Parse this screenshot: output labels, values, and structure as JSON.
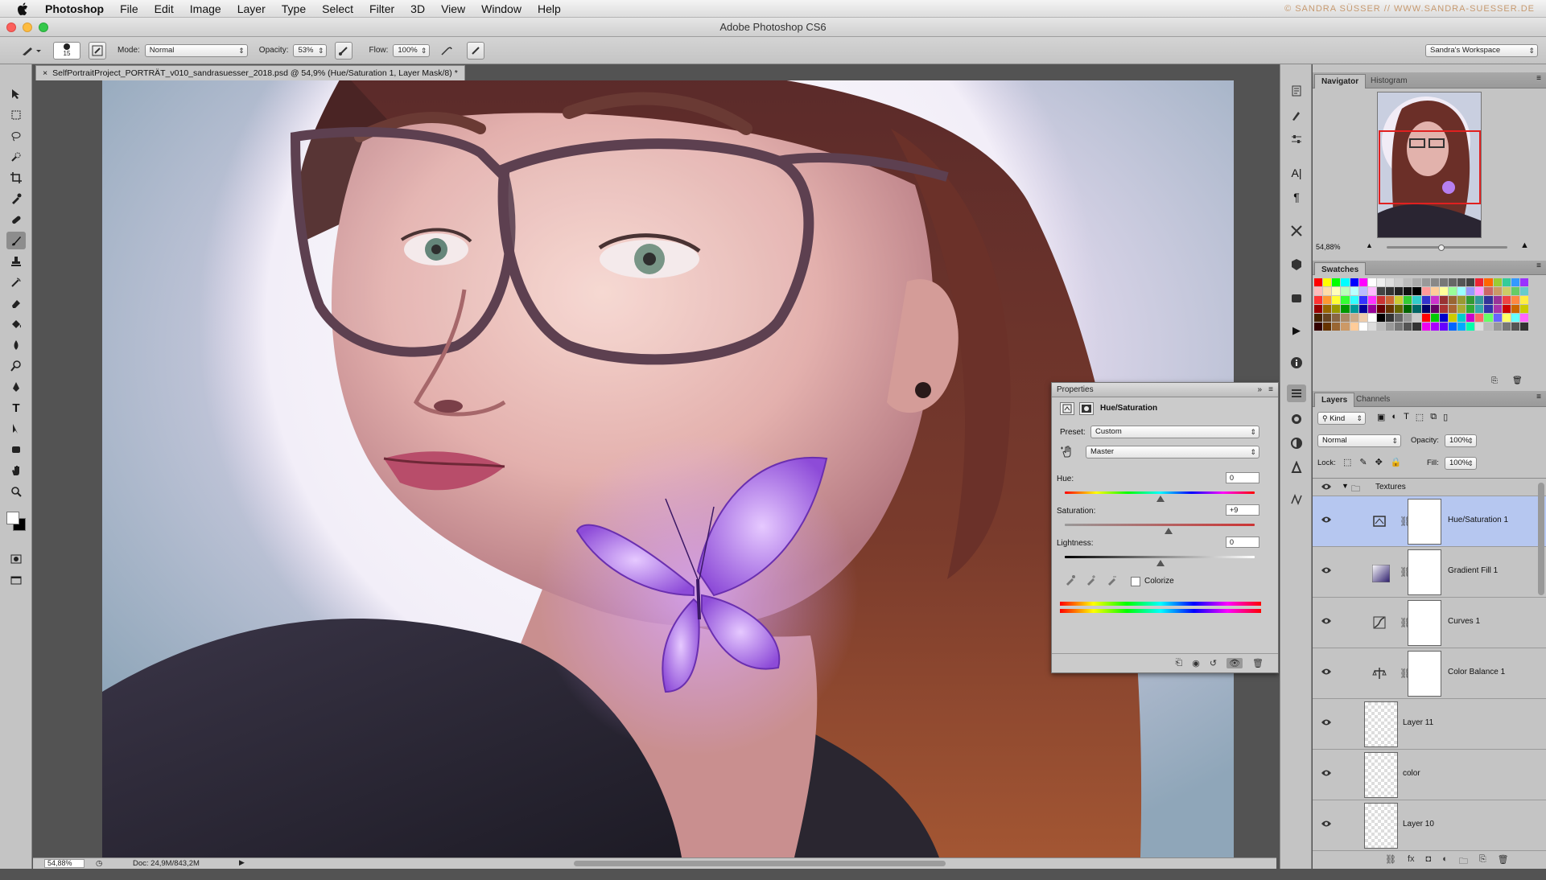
{
  "menubar": {
    "app": "Photoshop",
    "items": [
      "File",
      "Edit",
      "Image",
      "Layer",
      "Type",
      "Select",
      "Filter",
      "3D",
      "View",
      "Window",
      "Help"
    ],
    "credit": "© SANDRA SÜSSER // WWW.SANDRA-SUESSER.DE"
  },
  "window": {
    "title": "Adobe Photoshop CS6"
  },
  "options": {
    "brush_size": "15",
    "mode_label": "Mode:",
    "mode_value": "Normal",
    "opacity_label": "Opacity:",
    "opacity_value": "53%",
    "flow_label": "Flow:",
    "flow_value": "100%",
    "workspace": "Sandra's Workspace"
  },
  "document": {
    "tab_title": "SelfPortraitProject_PORTRÄT_v010_sandrasuesser_2018.psd @ 54,9% (Hue/Saturation 1, Layer Mask/8) *",
    "zoom": "54,88%",
    "doc_size": "Doc: 24,9M/843,2M"
  },
  "properties": {
    "panel_title": "Properties",
    "adjustment": "Hue/Saturation",
    "preset_label": "Preset:",
    "preset_value": "Custom",
    "channel_value": "Master",
    "hue_label": "Hue:",
    "hue_value": "0",
    "saturation_label": "Saturation:",
    "saturation_value": "+9",
    "lightness_label": "Lightness:",
    "lightness_value": "0",
    "colorize_label": "Colorize"
  },
  "navigator": {
    "tabs": [
      "Navigator",
      "Histogram"
    ],
    "zoom": "54,88%"
  },
  "swatches": {
    "title": "Swatches"
  },
  "layers_panel": {
    "tabs": [
      "Layers",
      "Channels"
    ],
    "kind_label": "Kind",
    "blend_mode": "Normal",
    "opacity_label": "Opacity:",
    "opacity_value": "100%",
    "lock_label": "Lock:",
    "fill_label": "Fill:",
    "fill_value": "100%",
    "group_name": "Textures",
    "layers": [
      {
        "name": "Hue/Saturation 1",
        "icon": "hue-saturation-icon",
        "selected": true
      },
      {
        "name": "Gradient Fill 1",
        "icon": "gradient-icon",
        "selected": false
      },
      {
        "name": "Curves 1",
        "icon": "curves-icon",
        "selected": false
      },
      {
        "name": "Color Balance 1",
        "icon": "balance-icon",
        "selected": false
      },
      {
        "name": "Layer 11",
        "icon": "",
        "selected": false
      },
      {
        "name": "color",
        "icon": "",
        "selected": false
      },
      {
        "name": "Layer 10",
        "icon": "",
        "selected": false
      }
    ]
  },
  "colors": {
    "selection": "#b6c7f0",
    "panel": "#c4c4c4",
    "accent_red": "#e02020"
  }
}
